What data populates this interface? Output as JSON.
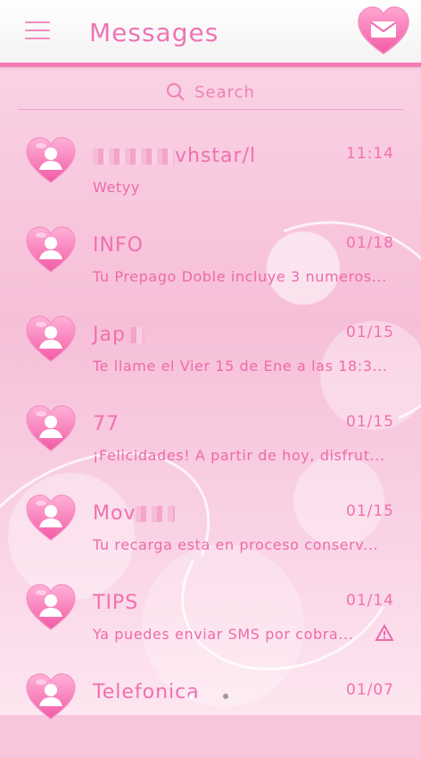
{
  "header": {
    "title": "Messages",
    "menu_icon": "hamburger-menu-icon",
    "compose_icon": "heart-envelope-icon"
  },
  "search": {
    "label": "Search",
    "icon": "search-icon"
  },
  "conversations": [
    {
      "name": "vhstar/l",
      "name_prefix_blurred": true,
      "time": "11:14",
      "snippet": "Wetyy",
      "avatar": "heart-avatar-icon"
    },
    {
      "name": "INFO",
      "time": "01/18",
      "snippet": "Tu Prepago Doble incluye 3 numeros...",
      "avatar": "heart-avatar-icon"
    },
    {
      "name": "Jap",
      "name_suffix_blurred": true,
      "time": "01/15",
      "snippet": "Te llame el Vier 15 de Ene a las 18:3...",
      "avatar": "heart-avatar-icon"
    },
    {
      "name": "77",
      "time": "01/15",
      "snippet": "¡Felicidades! A partir de hoy, disfrut...",
      "avatar": "heart-avatar-icon"
    },
    {
      "name": "Mov",
      "name_suffix_blurred": true,
      "time": "01/15",
      "snippet": "Tu recarga esta en proceso conserv...",
      "avatar": "heart-avatar-icon"
    },
    {
      "name": "TIPS",
      "time": "01/14",
      "snippet": "Ya puedes enviar SMS por cobra...",
      "avatar": "heart-avatar-icon",
      "status_icon": "warning-icon"
    },
    {
      "name": "Telefonica",
      "time": "01/07",
      "snippet": "",
      "avatar": "heart-avatar-icon"
    }
  ],
  "colors": {
    "accent": "#f070b0",
    "header_bar": "#f77ab8"
  }
}
